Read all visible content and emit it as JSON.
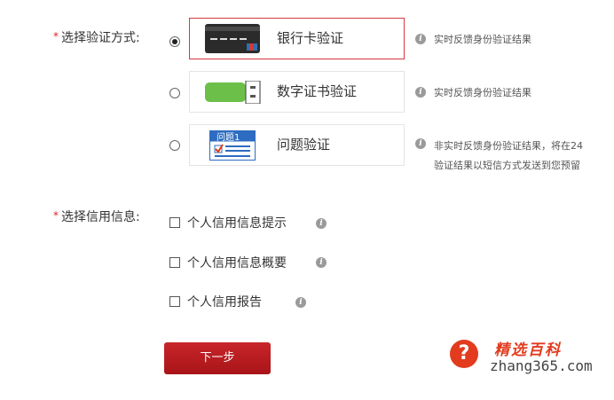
{
  "verify": {
    "required_mark": "*",
    "label": "选择验证方式:",
    "options": [
      {
        "label": "银行卡验证",
        "hint": "实时反馈身份验证结果",
        "selected": true
      },
      {
        "label": "数字证书验证",
        "hint": "实时反馈身份验证结果",
        "selected": false
      },
      {
        "label": "问题验证",
        "hint_line1": "非实时反馈身份验证结果，将在24",
        "hint_line2": "验证结果以短信方式发送到您预留",
        "selected": false
      }
    ],
    "question_icon_text": "问题1"
  },
  "credit": {
    "required_mark": "*",
    "label": "选择信用信息:",
    "items": [
      {
        "label": "个人信用信息提示"
      },
      {
        "label": "个人信用信息概要"
      },
      {
        "label": "个人信用报告"
      }
    ]
  },
  "next_button": {
    "label": "下一步"
  },
  "watermark": {
    "mark": "?",
    "brand": "精选百科",
    "url": "zhang365.com"
  },
  "colors": {
    "accent": "#d9363e",
    "button": "#b81c20",
    "watermark": "#e23b1e"
  }
}
